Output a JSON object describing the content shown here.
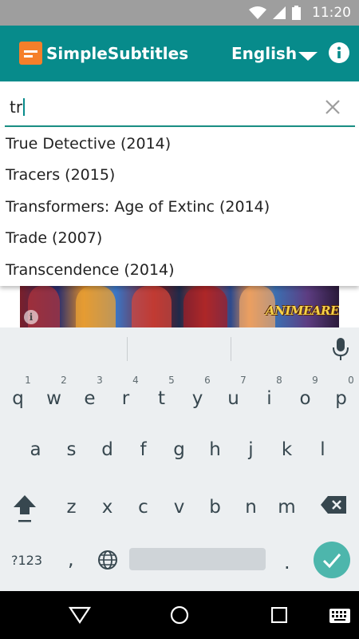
{
  "status_bar": {
    "time": "11:20",
    "icons": [
      "wifi-icon",
      "signal-icon",
      "battery-icon"
    ]
  },
  "app_bar": {
    "title": "SimpleSubtitles",
    "language": "English",
    "colors": {
      "bar": "#078b8b",
      "logo": "#f57f2a"
    }
  },
  "search": {
    "value": "tr"
  },
  "suggestions": [
    "True Detective (2014)",
    "Tracers (2015)",
    "Transformers: Age of Extinc (2014)",
    "Trade (2007)",
    "Transcendence (2014)"
  ],
  "ad": {
    "brand_text": "ANIMEARENA",
    "info_label": "i"
  },
  "keyboard": {
    "row1": [
      {
        "ch": "q",
        "hint": "1"
      },
      {
        "ch": "w",
        "hint": "2"
      },
      {
        "ch": "e",
        "hint": "3"
      },
      {
        "ch": "r",
        "hint": "4"
      },
      {
        "ch": "t",
        "hint": "5"
      },
      {
        "ch": "y",
        "hint": "6"
      },
      {
        "ch": "u",
        "hint": "7"
      },
      {
        "ch": "i",
        "hint": "8"
      },
      {
        "ch": "o",
        "hint": "9"
      },
      {
        "ch": "p",
        "hint": "0"
      }
    ],
    "row2": [
      "a",
      "s",
      "d",
      "f",
      "g",
      "h",
      "j",
      "k",
      "l"
    ],
    "row3": [
      "z",
      "x",
      "c",
      "v",
      "b",
      "n",
      "m"
    ],
    "symbols_label": "?123",
    "comma": ",",
    "period": "."
  }
}
